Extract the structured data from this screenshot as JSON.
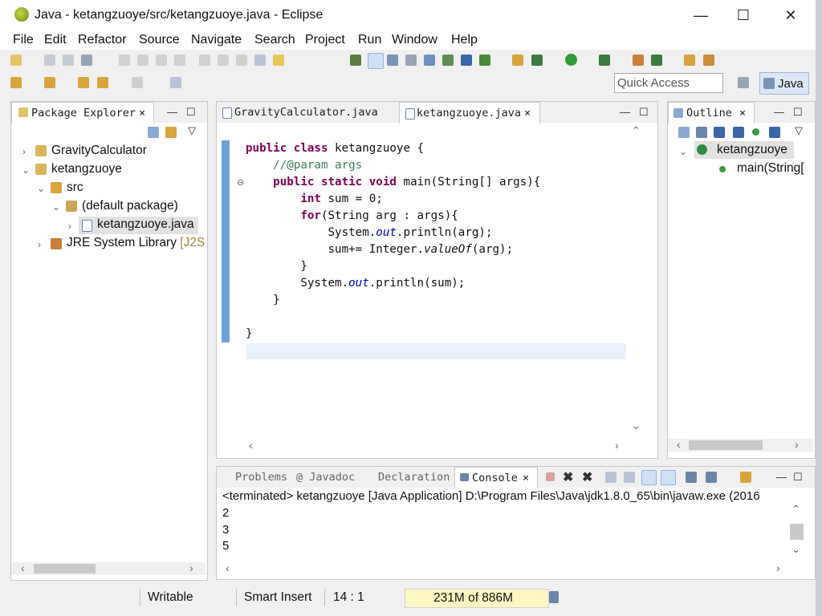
{
  "window": {
    "title": "Java - ketangzuoye/src/ketangzuoye.java - Eclipse"
  },
  "window_controls": {
    "minimize": "—",
    "maximize": "☐",
    "close": "✕"
  },
  "menubar": [
    "File",
    "Edit",
    "Refactor",
    "Source",
    "Navigate",
    "Search",
    "Project",
    "Run",
    "Window",
    "Help"
  ],
  "quick_access": {
    "placeholder": "Quick Access"
  },
  "perspective": {
    "label": "Java"
  },
  "package_explorer": {
    "tab_label": "Package Explorer",
    "tree": [
      {
        "label": "GravityCalculator",
        "icon": "project-icon",
        "expanded": false
      },
      {
        "label": "ketangzuoye",
        "icon": "project-icon",
        "expanded": true
      },
      {
        "label": "src",
        "icon": "source-folder-icon",
        "expanded": true
      },
      {
        "label": "(default package)",
        "icon": "package-icon",
        "expanded": true
      },
      {
        "label": "ketangzuoye.java",
        "icon": "java-file-icon",
        "selected": true
      },
      {
        "label": "JRE System Library",
        "suffix": "[J2S",
        "icon": "library-icon",
        "expanded": false
      }
    ]
  },
  "editor": {
    "tabs": [
      {
        "label": "GravityCalculator.java",
        "active": false
      },
      {
        "label": "ketangzuoye.java",
        "active": true
      }
    ],
    "code": [
      "public class ketangzuoye {",
      "    //@param args",
      "    public static void main(String[] args){",
      "        int sum = 0;",
      "        for(String arg : args){",
      "            System.out.println(arg);",
      "            sum+= Integer.valueOf(arg);",
      "        }",
      "        System.out.println(sum);",
      "    }",
      "",
      "}"
    ]
  },
  "outline": {
    "tab_label": "Outline",
    "items": [
      {
        "label": "ketangzuoye",
        "icon": "class-icon"
      },
      {
        "label": "main(String[",
        "icon": "method-icon"
      }
    ]
  },
  "bottom_tabs": [
    {
      "label": "Problems",
      "active": false
    },
    {
      "label": "Javadoc",
      "active": false
    },
    {
      "label": "Declaration",
      "active": false
    },
    {
      "label": "Console",
      "active": true
    }
  ],
  "console": {
    "header": "<terminated> ketangzuoye [Java Application] D:\\Program Files\\Java\\jdk1.8.0_65\\bin\\javaw.exe (2016",
    "lines": [
      "2",
      "3",
      "5"
    ]
  },
  "status": {
    "writable": "Writable",
    "insert_mode": "Smart Insert",
    "position": "14 : 1",
    "heap": "231M of 886M"
  },
  "colors": {
    "keyword": "#7f0055",
    "comment": "#3f7f5f",
    "field": "#0000c0",
    "selection": "#dbe7f7"
  }
}
